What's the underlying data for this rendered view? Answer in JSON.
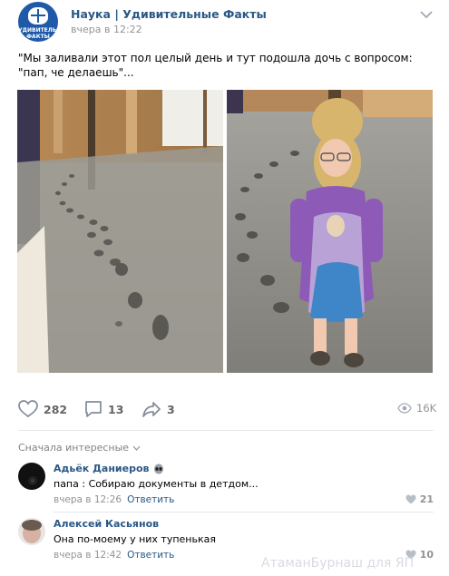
{
  "post": {
    "group_name": "Наука | Удивительные Факты",
    "avatar_text": "УДИВИТЕЛЬНЫЕ ФАКТЫ",
    "time": "вчера в 12:22",
    "menu_icon": "chevron-down-icon",
    "text": "\"Мы заливали этот пол целый день и тут подошла дочь с вопросом: \"пап, че делаешь\"..."
  },
  "photos": [
    {
      "name": "concrete-floor-footprints-photo"
    },
    {
      "name": "girl-on-concrete-floor-photo"
    }
  ],
  "actions": {
    "likes": "282",
    "comments": "13",
    "shares": "3",
    "views": "16K",
    "icons": {
      "like": "heart-icon",
      "comment": "comment-bubble-icon",
      "share": "share-arrow-icon",
      "views": "eye-icon"
    }
  },
  "comments_section": {
    "sort_label": "Сначала интересные"
  },
  "comments": [
    {
      "author": "Адьёк Даниеров",
      "text": "папа : Собираю документы в детдом...",
      "time": "вчера в 12:26",
      "reply_label": "Ответить",
      "likes": "21",
      "badge_icon": "alien-emoji-icon"
    },
    {
      "author": "Алексей Касьянов",
      "text": "Она по-моему у них тупенькая",
      "time": "вчера в 12:42",
      "reply_label": "Ответить",
      "likes": "10"
    }
  ],
  "watermark": "АтаманБурнаш для ЯП",
  "colors": {
    "link": "#2a5885",
    "muted": "#939393",
    "divider": "#e7e8ec",
    "avatar_bg": "#1f5aa8"
  }
}
